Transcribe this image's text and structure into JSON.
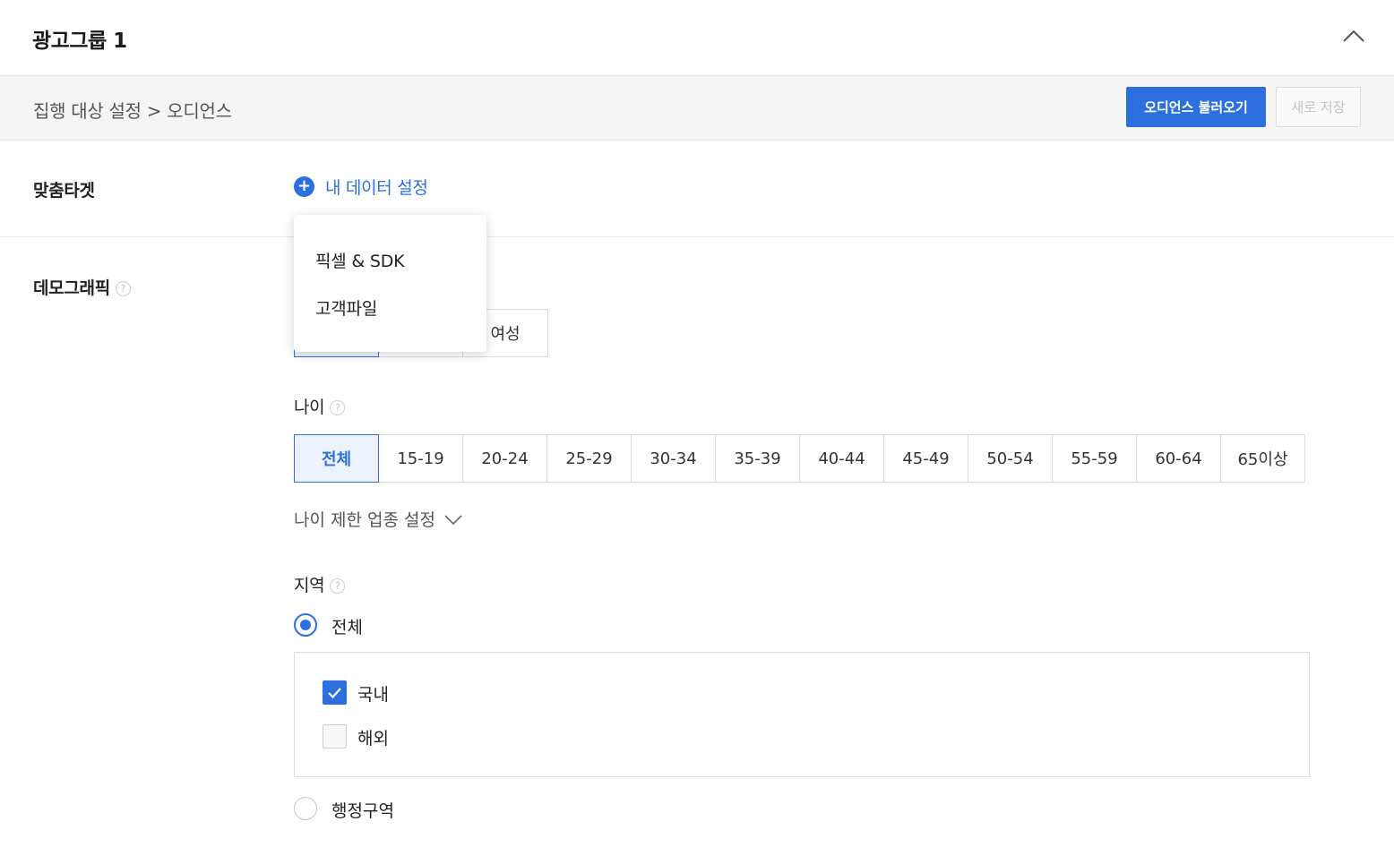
{
  "header": {
    "group_title": "광고그룹 1"
  },
  "subbar": {
    "breadcrumb": "집행 대상 설정 > 오디언스",
    "load_audience_label": "오디언스 불러오기",
    "save_new_label": "새로 저장"
  },
  "custom_target": {
    "label": "맞춤타겟",
    "add_my_data_label": "내 데이터 설정",
    "dropdown_items": [
      "픽셀 & SDK",
      "고객파일"
    ]
  },
  "demographic": {
    "label": "데모그래픽",
    "help": "?",
    "gender_options": [
      "",
      "",
      "여성"
    ],
    "age": {
      "label": "나이",
      "help": "?",
      "options": [
        "전체",
        "15-19",
        "20-24",
        "25-29",
        "30-34",
        "35-39",
        "40-44",
        "45-49",
        "50-54",
        "55-59",
        "60-64",
        "65이상"
      ],
      "selected": "전체",
      "limit_toggle_label": "나이 제한 업종 설정"
    },
    "region": {
      "label": "지역",
      "help": "?",
      "radio_all_label": "전체",
      "radio_admin_label": "행정구역",
      "selected": "전체",
      "checkboxes": [
        {
          "label": "국내",
          "checked": true
        },
        {
          "label": "해외",
          "checked": false
        }
      ]
    }
  },
  "colors": {
    "accent": "#2e6fe0",
    "subbar_bg": "#f5f5f5",
    "border": "#d9d9d9"
  }
}
